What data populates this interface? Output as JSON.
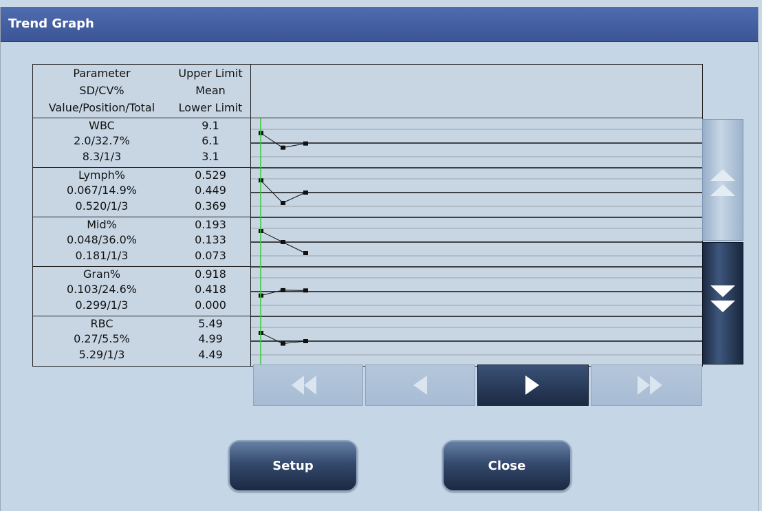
{
  "window": {
    "title": "Trend Graph"
  },
  "header": {
    "col1": [
      "Parameter",
      "SD/CV%",
      "Value/Position/Total"
    ],
    "col2": [
      "Upper Limit",
      "Mean",
      "Lower Limit"
    ]
  },
  "parameters": [
    {
      "name": "WBC",
      "sdcv": "2.0/32.7%",
      "vpt": "8.3/1/3",
      "upper": "9.1",
      "mean": "6.1",
      "lower": "3.1",
      "values": [
        8.3,
        5.1,
        6.0
      ]
    },
    {
      "name": "Lymph%",
      "sdcv": "0.067/14.9%",
      "vpt": "0.520/1/3",
      "upper": "0.529",
      "mean": "0.449",
      "lower": "0.369",
      "values": [
        0.52,
        0.389,
        0.449
      ]
    },
    {
      "name": "Mid%",
      "sdcv": "0.048/36.0%",
      "vpt": "0.181/1/3",
      "upper": "0.193",
      "mean": "0.133",
      "lower": "0.073",
      "values": [
        0.181,
        0.133,
        0.085
      ]
    },
    {
      "name": "Gran%",
      "sdcv": "0.103/24.6%",
      "vpt": "0.299/1/3",
      "upper": "0.918",
      "mean": "0.418",
      "lower": "0.000",
      "values": [
        0.299,
        0.47,
        0.46
      ]
    },
    {
      "name": "RBC",
      "sdcv": "0.27/5.5%",
      "vpt": "5.29/1/3",
      "upper": "5.49",
      "mean": "4.99",
      "lower": "4.49",
      "values": [
        5.29,
        4.9,
        4.99
      ]
    }
  ],
  "buttons": {
    "setup": "Setup",
    "close": "Close"
  },
  "icons": {
    "scroll_up": "double-up-triangle-icon",
    "scroll_down": "double-down-triangle-icon",
    "first": "double-left-triangle-icon",
    "prev": "left-triangle-icon",
    "next": "right-triangle-icon",
    "last": "double-right-triangle-icon"
  },
  "colors": {
    "cursor_line": "#33cc33",
    "title_bar": "#3f5a9c",
    "button_dark": "#23334f"
  }
}
